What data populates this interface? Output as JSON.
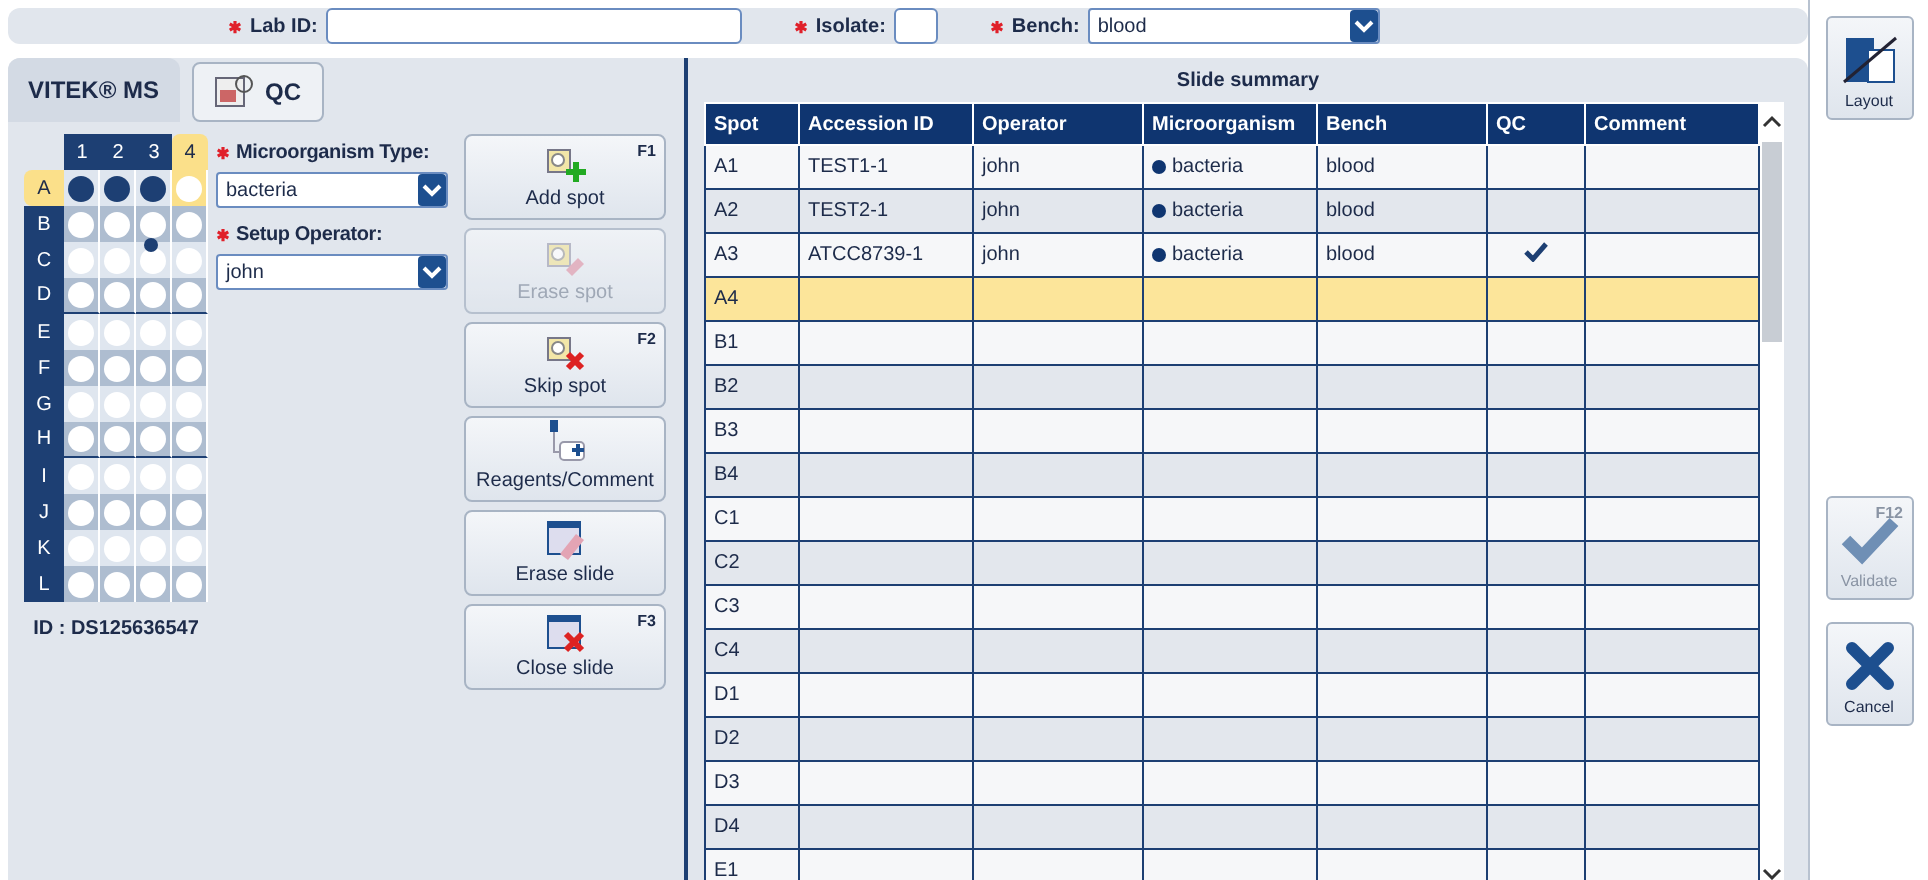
{
  "form": {
    "lab_id": {
      "label": "Lab ID:"
    },
    "isolate": {
      "label": "Isolate:"
    },
    "bench": {
      "label": "Bench:",
      "value": "blood"
    }
  },
  "tabs": [
    {
      "label": "VITEK® MS",
      "selected": true
    },
    {
      "label": "QC",
      "selected": false
    }
  ],
  "plate": {
    "columns": [
      {
        "label": "1",
        "selected": false
      },
      {
        "label": "2",
        "selected": false
      },
      {
        "label": "3",
        "selected": false
      },
      {
        "label": "4",
        "selected": true
      }
    ],
    "rows": [
      {
        "label": "A",
        "selected": true,
        "spots": [
          true,
          true,
          true,
          false
        ]
      },
      {
        "label": "B",
        "selected": false,
        "spots": [
          false,
          false,
          false,
          false
        ]
      },
      {
        "label": "C",
        "selected": false,
        "spots": [
          false,
          false,
          false,
          false
        ]
      },
      {
        "label": "D",
        "selected": false,
        "spots": [
          false,
          false,
          false,
          false
        ]
      },
      {
        "label": "E",
        "selected": false,
        "spots": [
          false,
          false,
          false,
          false
        ]
      },
      {
        "label": "F",
        "selected": false,
        "spots": [
          false,
          false,
          false,
          false
        ]
      },
      {
        "label": "G",
        "selected": false,
        "spots": [
          false,
          false,
          false,
          false
        ]
      },
      {
        "label": "H",
        "selected": false,
        "spots": [
          false,
          false,
          false,
          false
        ]
      },
      {
        "label": "I",
        "selected": false,
        "spots": [
          false,
          false,
          false,
          false
        ]
      },
      {
        "label": "J",
        "selected": false,
        "spots": [
          false,
          false,
          false,
          false
        ]
      },
      {
        "label": "K",
        "selected": false,
        "spots": [
          false,
          false,
          false,
          false
        ]
      },
      {
        "label": "L",
        "selected": false,
        "spots": [
          false,
          false,
          false,
          false
        ]
      }
    ],
    "id": "ID : DS125636547"
  },
  "setup": [
    {
      "label": "Microorganism Type:",
      "value": "bacteria"
    },
    {
      "label": "Setup Operator:",
      "value": "john"
    }
  ],
  "actions": [
    {
      "kind": "add",
      "label": "Add spot",
      "key": "F1",
      "disabled": false
    },
    {
      "kind": "erase-spot",
      "label": "Erase spot",
      "disabled": true
    },
    {
      "kind": "skip",
      "label": "Skip spot",
      "key": "F2",
      "disabled": false
    },
    {
      "kind": "reagents",
      "label": "Reagents/Comment",
      "disabled": false
    },
    {
      "kind": "erase-slide",
      "label": "Erase slide",
      "disabled": false
    },
    {
      "kind": "close",
      "label": "Close slide",
      "key": "F3",
      "disabled": false
    }
  ],
  "table": {
    "title": "Slide summary",
    "columns": [
      "Spot",
      "Accession ID",
      "Operator",
      "Microorganism",
      "Bench",
      "QC",
      "Comment"
    ],
    "rows": [
      {
        "spot": "A1",
        "accession_id": "TEST1-1",
        "operator": "john",
        "microorganism": "bacteria",
        "bench": "blood",
        "qc": false,
        "selected": false
      },
      {
        "spot": "A2",
        "accession_id": "TEST2-1",
        "operator": "john",
        "microorganism": "bacteria",
        "bench": "blood",
        "qc": false,
        "selected": false
      },
      {
        "spot": "A3",
        "accession_id": "ATCC8739-1",
        "operator": "john",
        "microorganism": "bacteria",
        "bench": "blood",
        "qc": true,
        "selected": false
      },
      {
        "spot": "A4",
        "selected": true
      },
      {
        "spot": "B1",
        "selected": false
      },
      {
        "spot": "B2",
        "selected": false
      },
      {
        "spot": "B3",
        "selected": false
      },
      {
        "spot": "B4",
        "selected": false
      },
      {
        "spot": "C1",
        "selected": false
      },
      {
        "spot": "C2",
        "selected": false
      },
      {
        "spot": "C3",
        "selected": false
      },
      {
        "spot": "C4",
        "selected": false
      },
      {
        "spot": "D1",
        "selected": false
      },
      {
        "spot": "D2",
        "selected": false
      },
      {
        "spot": "D3",
        "selected": false
      },
      {
        "spot": "D4",
        "selected": false
      },
      {
        "spot": "E1",
        "selected": false
      }
    ]
  },
  "sidebar": [
    {
      "kind": "layout",
      "label": "Layout",
      "disabled": false
    },
    {
      "kind": "validate",
      "label": "Validate",
      "key": "F12",
      "disabled": true
    },
    {
      "kind": "cancel",
      "label": "Cancel",
      "disabled": false
    }
  ]
}
